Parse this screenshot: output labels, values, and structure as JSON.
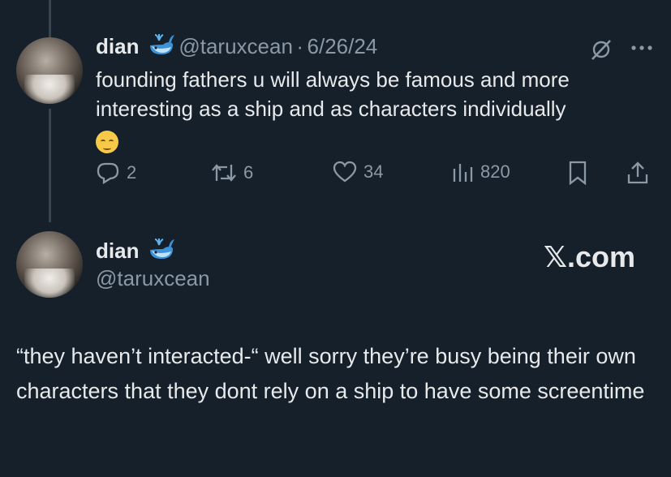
{
  "quoted_tweet": {
    "display_name": "dian",
    "handle": "@taruxcean",
    "separator": "·",
    "date": "6/26/24",
    "text": "founding fathers u will always be famous and more interesting as a ship and as characters individually",
    "emoji": "pensive-face",
    "replies": "2",
    "retweets": "6",
    "likes": "34",
    "views": "820"
  },
  "card": {
    "display_name": "dian",
    "handle": "@taruxcean",
    "logo_text": "𝕏.com",
    "text": "“they haven’t interacted-“ well sorry they’re busy being their own characters that they dont rely on a ship to have some screentime"
  }
}
